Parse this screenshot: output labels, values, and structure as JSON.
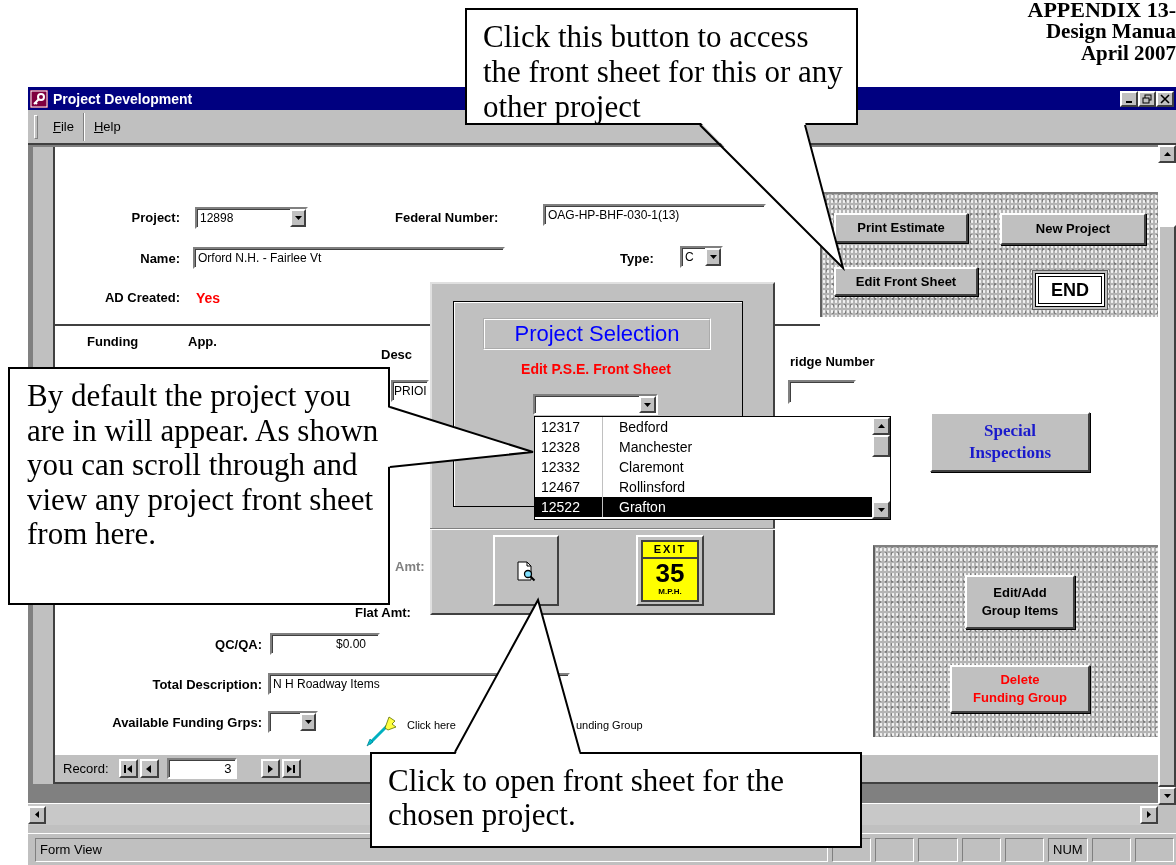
{
  "document_header": {
    "title": "APPENDIX 13-",
    "subtitle": "Design Manua",
    "date": "April 2007"
  },
  "window": {
    "title": "Project Development"
  },
  "menu": [
    "File",
    "Help"
  ],
  "form": {
    "project": {
      "label": "Project:",
      "value": "12898"
    },
    "federal_number": {
      "label": "Federal Number:",
      "value": "OAG-HP-BHF-030-1(13)"
    },
    "name": {
      "label": "Name:",
      "value": "Orford N.H. - Fairlee Vt"
    },
    "type": {
      "label": "Type:",
      "value": "C"
    },
    "ad_created": {
      "label": "AD Created:",
      "value": "Yes"
    },
    "top_buttons": [
      "Print Estimate",
      "New Project",
      "Edit Front Sheet",
      "END"
    ],
    "funding_columns": [
      "Funding",
      "App.",
      "Desc",
      "ridge Number"
    ],
    "description_value": "PRIOI",
    "special_inspections": "Special Inspections",
    "amt_label": "Amt:",
    "flat_amt_label": "Flat Amt:",
    "group_buttons": [
      {
        "label": "Edit/Add\nGroup Items",
        "kind": "normal"
      },
      {
        "label": "Delete\nFunding Group",
        "kind": "danger"
      }
    ],
    "qc_qa": {
      "label": "QC/QA:",
      "value": "$0.00"
    },
    "total_description": {
      "label": "Total Description:",
      "value": "N H Roadway Items"
    },
    "available_funding_grps": {
      "label": "Available Funding Grps:"
    },
    "hint_parts": [
      "Click here",
      "unding Group"
    ],
    "record_nav": {
      "label": "Record:",
      "value": "3"
    }
  },
  "dialog": {
    "title": "Project Selection",
    "subtitle": "Edit P.S.E. Front Sheet",
    "options": [
      {
        "number": "12317",
        "name": "Bedford",
        "selected": false
      },
      {
        "number": "12328",
        "name": "Manchester",
        "selected": false
      },
      {
        "number": "12332",
        "name": "Claremont",
        "selected": false
      },
      {
        "number": "12467",
        "name": "Rollinsford",
        "selected": false
      },
      {
        "number": "12522",
        "name": "Grafton",
        "selected": true
      }
    ],
    "exit_sign": {
      "top": "EXIT",
      "number": "35",
      "unit": "M.P.H."
    }
  },
  "status_bar": {
    "text": "Form View",
    "indicators": [
      "NUM"
    ]
  },
  "callouts": [
    {
      "text": "Click this button to access the front sheet for this or any other project"
    },
    {
      "text": "By default the project you are in will appear. As shown you can scroll through and view any project front sheet from here."
    },
    {
      "text": "Click to open front sheet for the chosen project."
    }
  ]
}
